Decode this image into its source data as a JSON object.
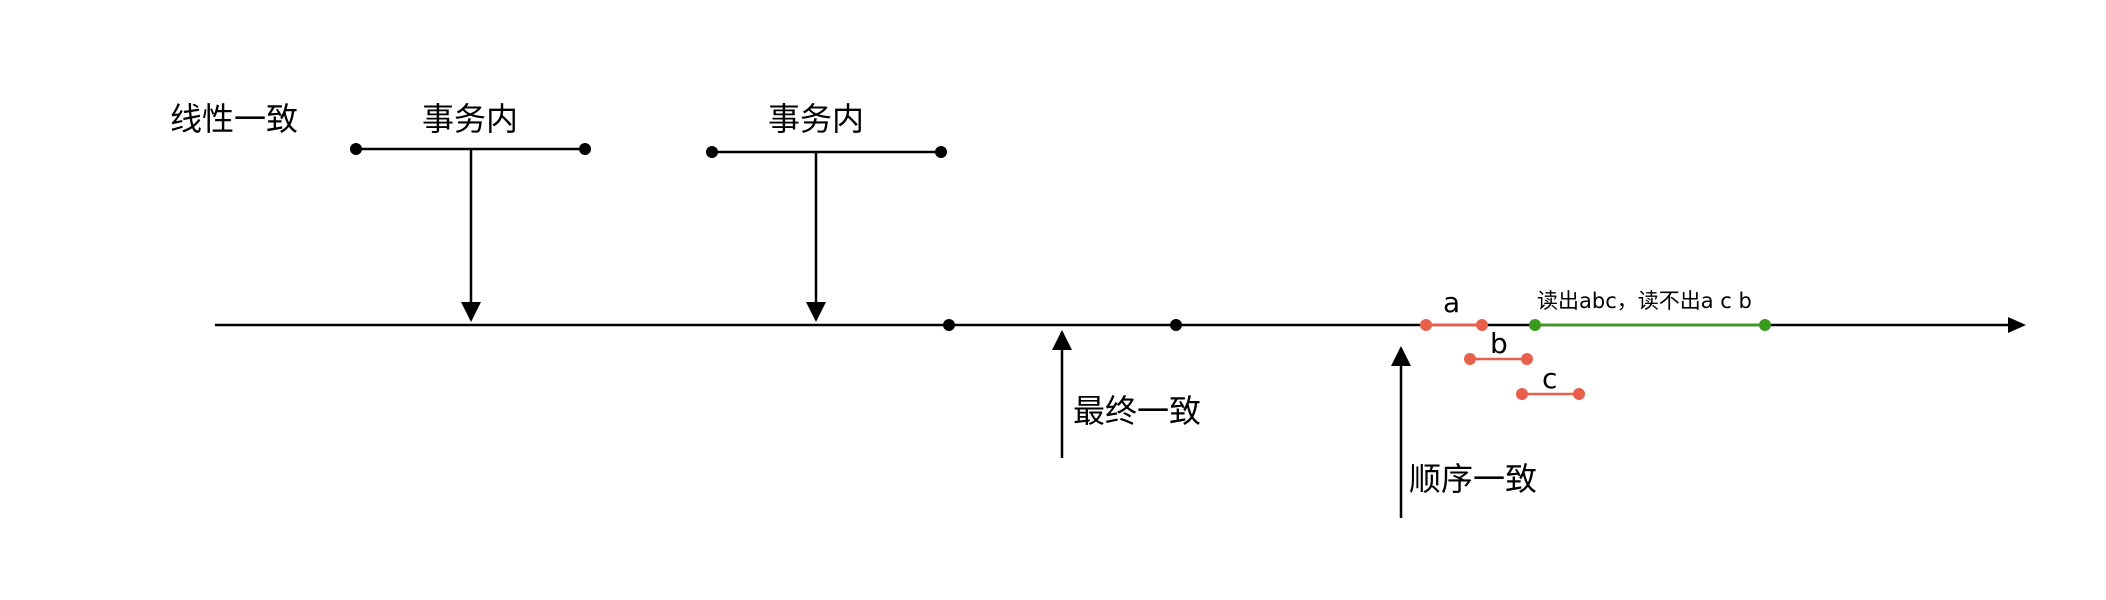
{
  "labels": {
    "linearizable": "线性一致",
    "transaction_1": "事务内",
    "transaction_2": "事务内",
    "eventual": "最终一致",
    "sequential": "顺序一致",
    "seg_a": "a",
    "seg_b": "b",
    "seg_c": "c",
    "read_note": "读出abc，读不出a c b"
  },
  "colors": {
    "line": "#000000",
    "write_segment": "#e8604c",
    "read_segment": "#3a9a1e"
  }
}
